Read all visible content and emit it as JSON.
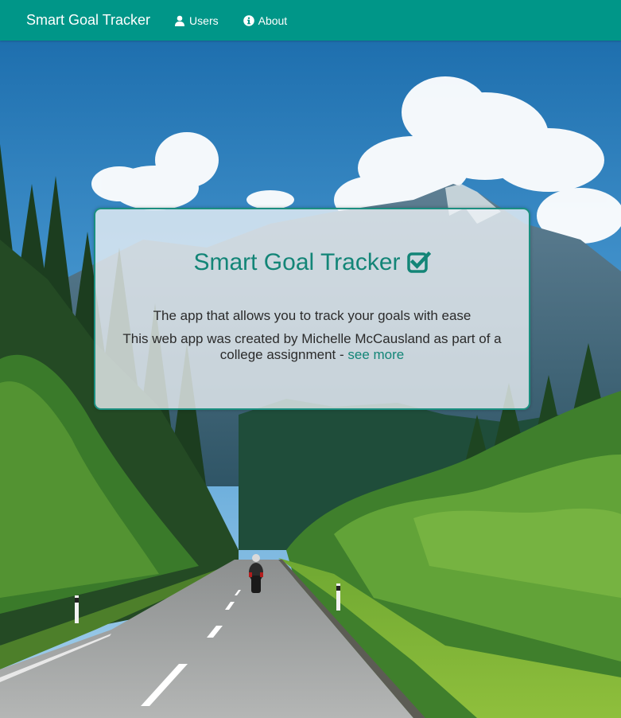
{
  "navbar": {
    "brand": "Smart Goal Tracker",
    "items": [
      {
        "label": "Users",
        "icon": "user-icon"
      },
      {
        "label": "About",
        "icon": "info-icon"
      }
    ],
    "background_color": "#009688",
    "text_color": "#ffffff"
  },
  "hero_card": {
    "title": "Smart Goal Tracker",
    "title_icon": "check-square-icon",
    "tagline": "The app that allows you to track your goals with ease",
    "credit_text": "This web app was created by Michelle McCausland as part of a college assignment - ",
    "credit_link": "see more",
    "accent_color": "#138577"
  },
  "background": {
    "image": "mountain-road-landscape"
  }
}
